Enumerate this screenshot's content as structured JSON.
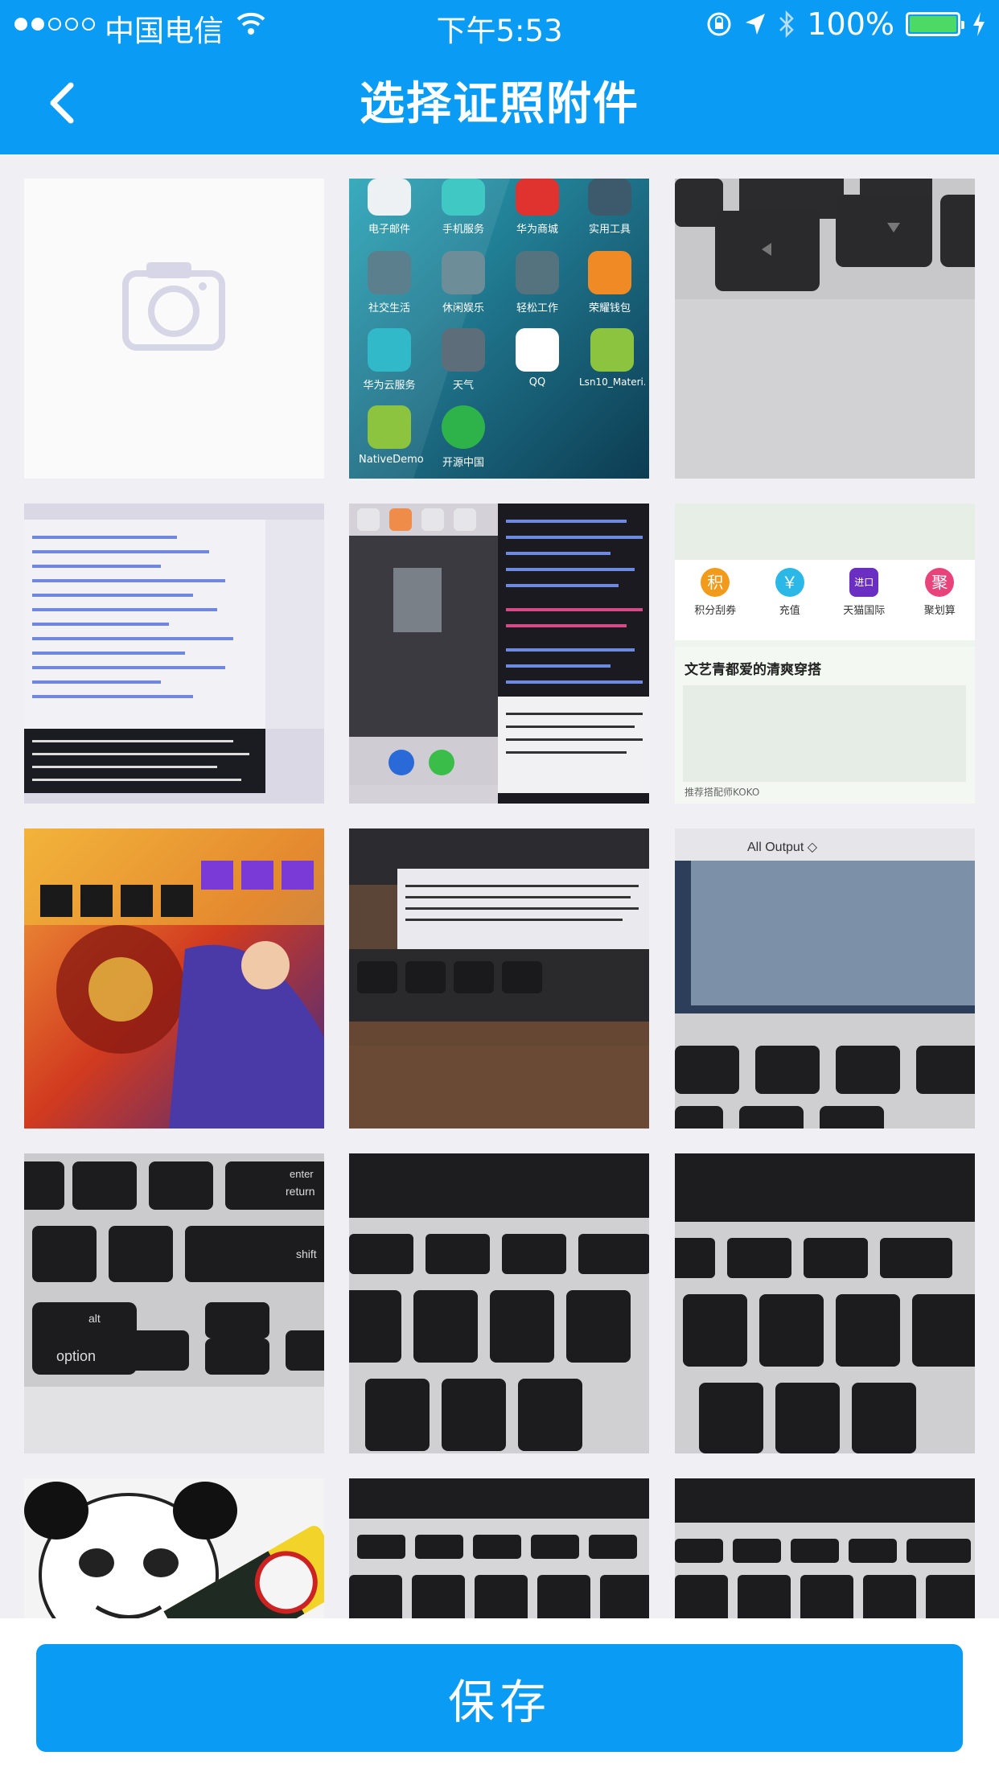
{
  "status_bar": {
    "carrier": "中国电信",
    "time": "下午5:53",
    "battery": "100%"
  },
  "nav": {
    "title": "选择证照附件",
    "back_icon": "chevron-left-icon"
  },
  "grid": {
    "camera_icon": "camera-icon",
    "photos": [
      "camera",
      "phone-homescreen-photo",
      "keyboard-arrow-keys-photo",
      "code-screen-photo-1",
      "phone-and-code-photo",
      "app-screenshot",
      "game-banner-photo",
      "laptop-screen-photo-1",
      "laptop-screen-photo-2",
      "keyboard-keys-photo-1",
      "keyboard-keys-photo-2",
      "keyboard-keys-photo-3",
      "panda-meme-photo",
      "keyboard-keys-photo-4",
      "keyboard-keys-photo-5"
    ],
    "homescreen_apps": [
      "电子邮件",
      "手机服务",
      "华为商城",
      "实用工具",
      "社交生活",
      "休闲娱乐",
      "轻松工作",
      "荣耀钱包",
      "华为云服务",
      "天气",
      "QQ",
      "Lsn10_Materi...",
      "NativeDemo",
      "开源中国"
    ],
    "app_screenshot": {
      "shortcuts": [
        "积分刮券",
        "充值",
        "天猫国际",
        "聚划算"
      ],
      "shortcut_glyphs": [
        "积",
        "￥",
        "进口",
        "聚"
      ],
      "section_title": "文艺青都爱的清爽穿搭",
      "footer": "推荐搭配师KOKO"
    },
    "keyboard_labels": {
      "alt": "alt",
      "option": "option",
      "enter": "enter",
      "return": "return",
      "shift": "shift",
      "all_output": "All Output ◇"
    }
  },
  "footer": {
    "save_label": "保存"
  },
  "colors": {
    "accent": "#0a9cf5",
    "background": "#efeff4",
    "battery": "#4cd964"
  }
}
